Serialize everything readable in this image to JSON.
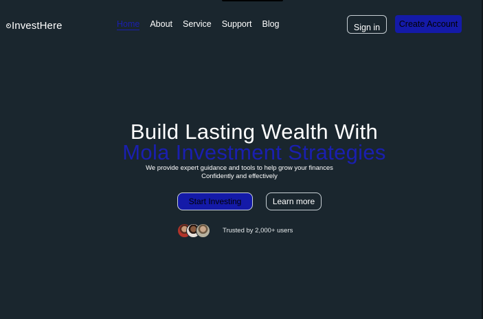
{
  "brand": {
    "name": "InvestHere",
    "logo_icon": "circle-logo-icon"
  },
  "nav": {
    "items": [
      {
        "label": "Home",
        "active": true
      },
      {
        "label": "About",
        "active": false
      },
      {
        "label": "Service",
        "active": false
      },
      {
        "label": "Support",
        "active": false
      },
      {
        "label": "Blog",
        "active": false
      }
    ]
  },
  "header_actions": {
    "sign_in": "Sign in",
    "create_account": "Create Account"
  },
  "hero": {
    "title_line1": "Build Lasting Wealth With",
    "title_line2": "Mola Investment Strategies",
    "subtitle_line1": "We provide expert guidance and tools to help grow your finances",
    "subtitle_line2": "Confidently and effectively",
    "primary_cta": "Start Investing",
    "secondary_cta": "Learn more"
  },
  "social_proof": {
    "text": "Trusted by 2,000+ users",
    "avatars": [
      "user-avatar",
      "user-avatar",
      "user-avatar"
    ]
  },
  "colors": {
    "background": "#1a262e",
    "accent": "#141aa8",
    "accent_text": "#1a1fb0",
    "text": "#ffffff"
  }
}
